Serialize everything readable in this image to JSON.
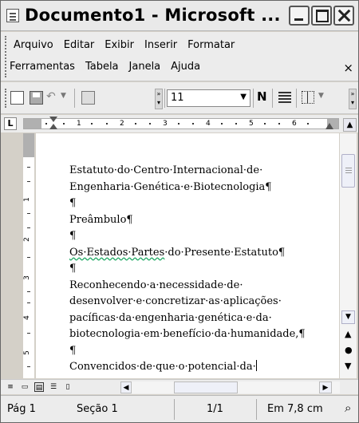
{
  "window": {
    "title": "Documento1 - Microsoft ...",
    "icons": [
      "word-app-icon",
      "minimize-icon",
      "maximize-icon",
      "close-icon"
    ]
  },
  "menu": {
    "row1": [
      "Arquivo",
      "Editar",
      "Exibir",
      "Inserir",
      "Formatar"
    ],
    "row2": [
      "Ferramentas",
      "Tabela",
      "Janela",
      "Ajuda"
    ],
    "close_doc": "×"
  },
  "toolbar": {
    "font_size": "11",
    "bold_label": "N",
    "icons": [
      "new-document-icon",
      "save-icon",
      "undo-icon",
      "research-icon",
      "align-icon",
      "borders-icon"
    ]
  },
  "ruler": {
    "tab_marker": "L",
    "numbers": [
      "1",
      "2",
      "3",
      "4",
      "5",
      "6"
    ]
  },
  "vruler": {
    "numbers": [
      "1",
      "2",
      "3",
      "4",
      "5"
    ]
  },
  "document": {
    "lines": [
      "Estatuto·do·Centro·Internacional·de·",
      "Engenharia·Genética·e·Biotecnologia¶",
      "¶",
      "Preâmbulo¶",
      "¶",
      "Os·Estados·Partes·do·Presente·Estatuto¶",
      "¶",
      "Reconhecendo·a·necessidade·de·",
      "desenvolver·e·concretizar·as·aplicações·",
      "pacíficas·da·engenharia·genética·e·da·",
      "biotecnologia·em·benefício·da·humanidade,¶",
      "¶",
      "Convencidos·de·que·o·potencial·da·"
    ],
    "wavy_part": "Os·Estados·Partes",
    "wavy_rest": "·do·Presente·Estatuto¶"
  },
  "status": {
    "page": "Pág 1",
    "section": "Seção 1",
    "page_of": "1/1",
    "position": "Em 7,8 cm"
  },
  "colors": {
    "spell_underline": "#22aa66",
    "chrome": "#ececec"
  }
}
